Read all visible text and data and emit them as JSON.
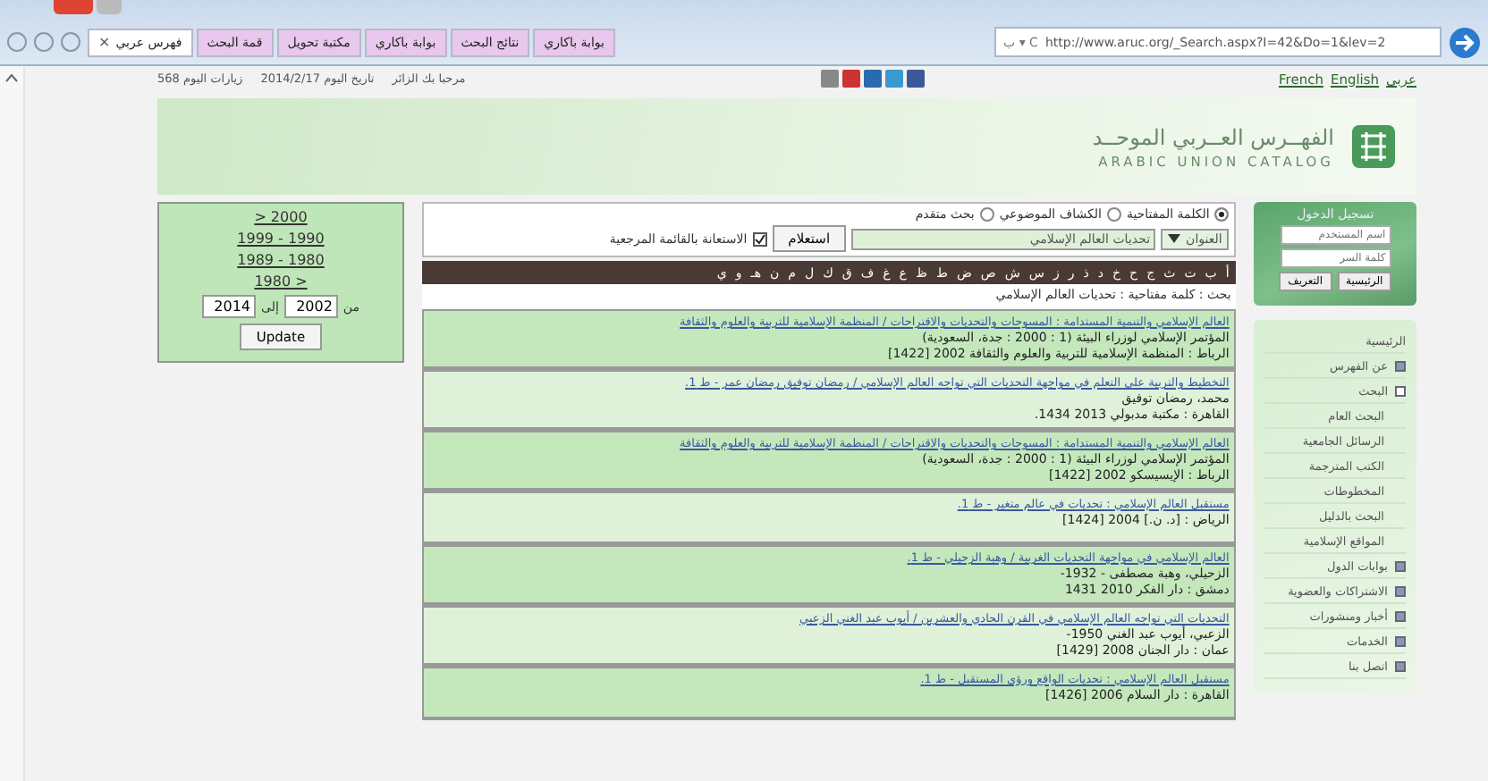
{
  "browser": {
    "url": "http://www.aruc.org/_Search.aspx?I=42&Do=1&lev=2",
    "address_hint": "ب ▾ C",
    "tabs": [
      {
        "label": "بوابة باكاري",
        "selected": false
      },
      {
        "label": "نتائج البحث",
        "selected": false
      },
      {
        "label": "بوابة باكاري",
        "selected": false
      },
      {
        "label": "مكتبة تحويل",
        "selected": false
      },
      {
        "label": "قمة البحث",
        "selected": false
      },
      {
        "label": "فهرس عربي",
        "selected": true
      }
    ],
    "close": "×"
  },
  "top_bar": {
    "stats": [
      "مرحبا بك الزائر",
      "تاريخ اليوم 2014/2/17",
      "زيارات اليوم 568"
    ],
    "languages": [
      "عربي",
      "English",
      "French"
    ]
  },
  "header": {
    "title_ar": "الفهــرس العــربي الموحــد",
    "title_en": "ARABIC UNION CATALOG"
  },
  "date_filter": {
    "ranges": [
      "> 2000",
      "1999 - 1990",
      "1989 - 1980",
      "1980 >"
    ],
    "from_label": "من",
    "from": "2002",
    "to_label": "إلى",
    "to": "2014",
    "button": "Update"
  },
  "search": {
    "modes": [
      {
        "label": "الكلمة المفتاحية",
        "selected": true
      },
      {
        "label": "الكشاف الموضوعي",
        "selected": false
      },
      {
        "label": "بحث متقدم",
        "selected": false
      }
    ],
    "field_select": "العنوان",
    "query": "تحديات العالم الإسلامي",
    "submit": "استعلام",
    "refine": {
      "label": "الاستعانة بالقائمة المرجعية",
      "checked": true
    },
    "letters": [
      "أ",
      "ب",
      "ت",
      "ث",
      "ج",
      "ح",
      "خ",
      "د",
      "ذ",
      "ر",
      "ز",
      "س",
      "ش",
      "ص",
      "ض",
      "ط",
      "ظ",
      "ع",
      "غ",
      "ف",
      "ق",
      "ك",
      "ل",
      "م",
      "ن",
      "هـ",
      "و",
      "ي"
    ],
    "summary": "بحث : كلمة مفتاحية : تحديات العالم الإسلامي"
  },
  "results": [
    {
      "title": "العالم الإسلامي والتنمية المستدامة : المسوحات والتحديات والاقتراحات / المنظمة الإسلامية للتربية والعلوم والثقافة",
      "lines": [
        "المؤتمر الإسلامي لوزراء البيئة (1 : 2000 : جدة، السعودية)",
        "الرباط : المنظمة الإسلامية للتربية والعلوم والثقافة 2002 [1422]"
      ]
    },
    {
      "title": "التخطيط والتربية على التعلم في مواجهة التحديات التي تواجه العالم الإسلامي / رمضان توفيق رمضان عمر - ط 1.",
      "lines": [
        "محمد، رمضان توفيق",
        "القاهرة : مكتبة مدبولي 2013 1434."
      ]
    },
    {
      "title": "العالم الإسلامي والتنمية المستدامة : المسوحات والتحديات والاقتراحات / المنظمة الإسلامية للتربية والعلوم والثقافة",
      "lines": [
        "المؤتمر الإسلامي لوزراء البيئة (1 : 2000 : جدة، السعودية)",
        "الرباط : الإيسيسكو 2002 [1422]"
      ]
    },
    {
      "title": "مستقبل العالم الإسلامي : تحديات في عالم متغير - ط 1.",
      "lines": [
        "الرياض : [د. ن.] 2004 [1424]"
      ]
    },
    {
      "title": "العالم الإسلامي في مواجهة التحديات الغربية / وهبة الزحيلي - ط 1.",
      "lines": [
        "الزحيلي، وهبة مصطفى - 1932-",
        "دمشق : دار الفكر 2010 1431"
      ]
    },
    {
      "title": "التحديات التي تواجه العالم الإسلامي في القرن الحادي والعشرين / أيوب عبد الغني الزعبي",
      "lines": [
        "الزعبي، أيوب عبد الغني 1950-",
        "عمان : دار الجنان 2008 [1429]"
      ]
    },
    {
      "title": "مستقبل العالم الإسلامي : تحديات الواقع ورؤى المستقبل - ط 1.",
      "lines": [
        "القاهرة : دار السلام 2006 [1426]"
      ]
    }
  ],
  "login": {
    "title": "تسجيل الدخول",
    "user_placeholder": "اسم المستخدم",
    "pass_placeholder": "كلمة السر",
    "buttons": [
      "الرئيسية",
      "التعريف"
    ]
  },
  "menu": [
    {
      "label": "الرئيسية",
      "kind": "plain"
    },
    {
      "label": "عن الفهرس",
      "kind": "folder"
    },
    {
      "label": "البحث",
      "kind": "folder",
      "expanded": true,
      "children": [
        "البحث العام",
        "الرسائل الجامعية",
        "الكتب المترجمة",
        "المخطوطات",
        "البحث بالدليل",
        "المواقع الإسلامية"
      ]
    },
    {
      "label": "بوابات الدول",
      "kind": "folder"
    },
    {
      "label": "الاشتراكات والعضوية",
      "kind": "folder"
    },
    {
      "label": "أخبار ومنشورات",
      "kind": "folder"
    },
    {
      "label": "الخدمات",
      "kind": "folder"
    },
    {
      "label": "اتصل بنا",
      "kind": "folder"
    }
  ]
}
